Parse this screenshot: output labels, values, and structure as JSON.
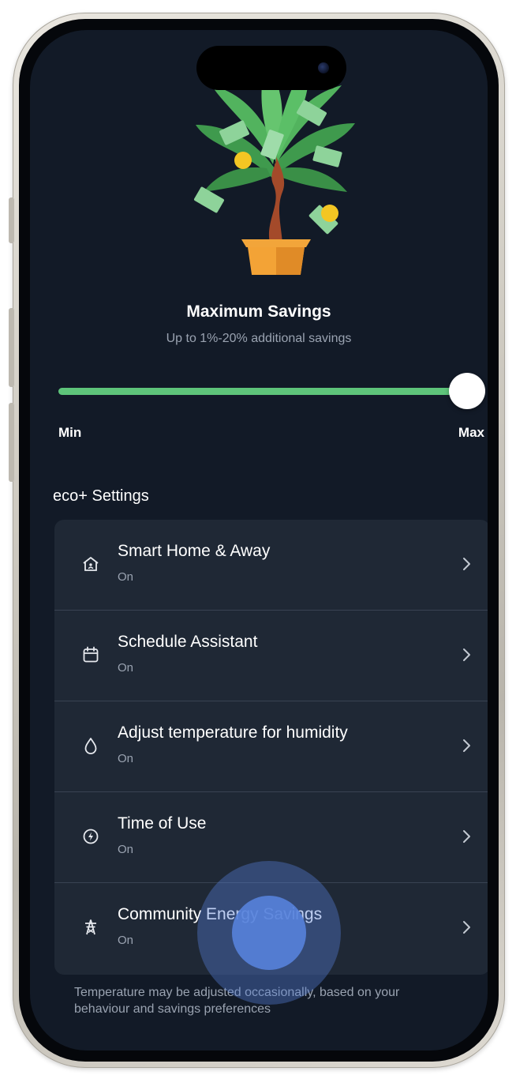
{
  "header": {
    "title": "Maximum Savings",
    "subtitle": "Up to 1%-20% additional savings"
  },
  "slider": {
    "min_label": "Min",
    "max_label": "Max",
    "value_fraction": 1.0
  },
  "settings": {
    "section_title": "eco+ Settings",
    "items": [
      {
        "label": "Smart Home & Away",
        "status": "On",
        "icon": "home-away-icon"
      },
      {
        "label": "Schedule Assistant",
        "status": "On",
        "icon": "calendar-icon"
      },
      {
        "label": "Adjust temperature for humidity",
        "status": "On",
        "icon": "water-drop-icon"
      },
      {
        "label": "Time of Use",
        "status": "On",
        "icon": "time-of-use-icon"
      },
      {
        "label": "Community Energy Savings",
        "status": "On",
        "icon": "power-tower-icon"
      }
    ]
  },
  "footnote": "Temperature may be adjusted occasionally, based on your behaviour and savings preferences",
  "colors": {
    "background": "#121a27",
    "card": "#1f2835",
    "accent_green": "#5ec47a",
    "touch_blue": "#5682dc"
  }
}
